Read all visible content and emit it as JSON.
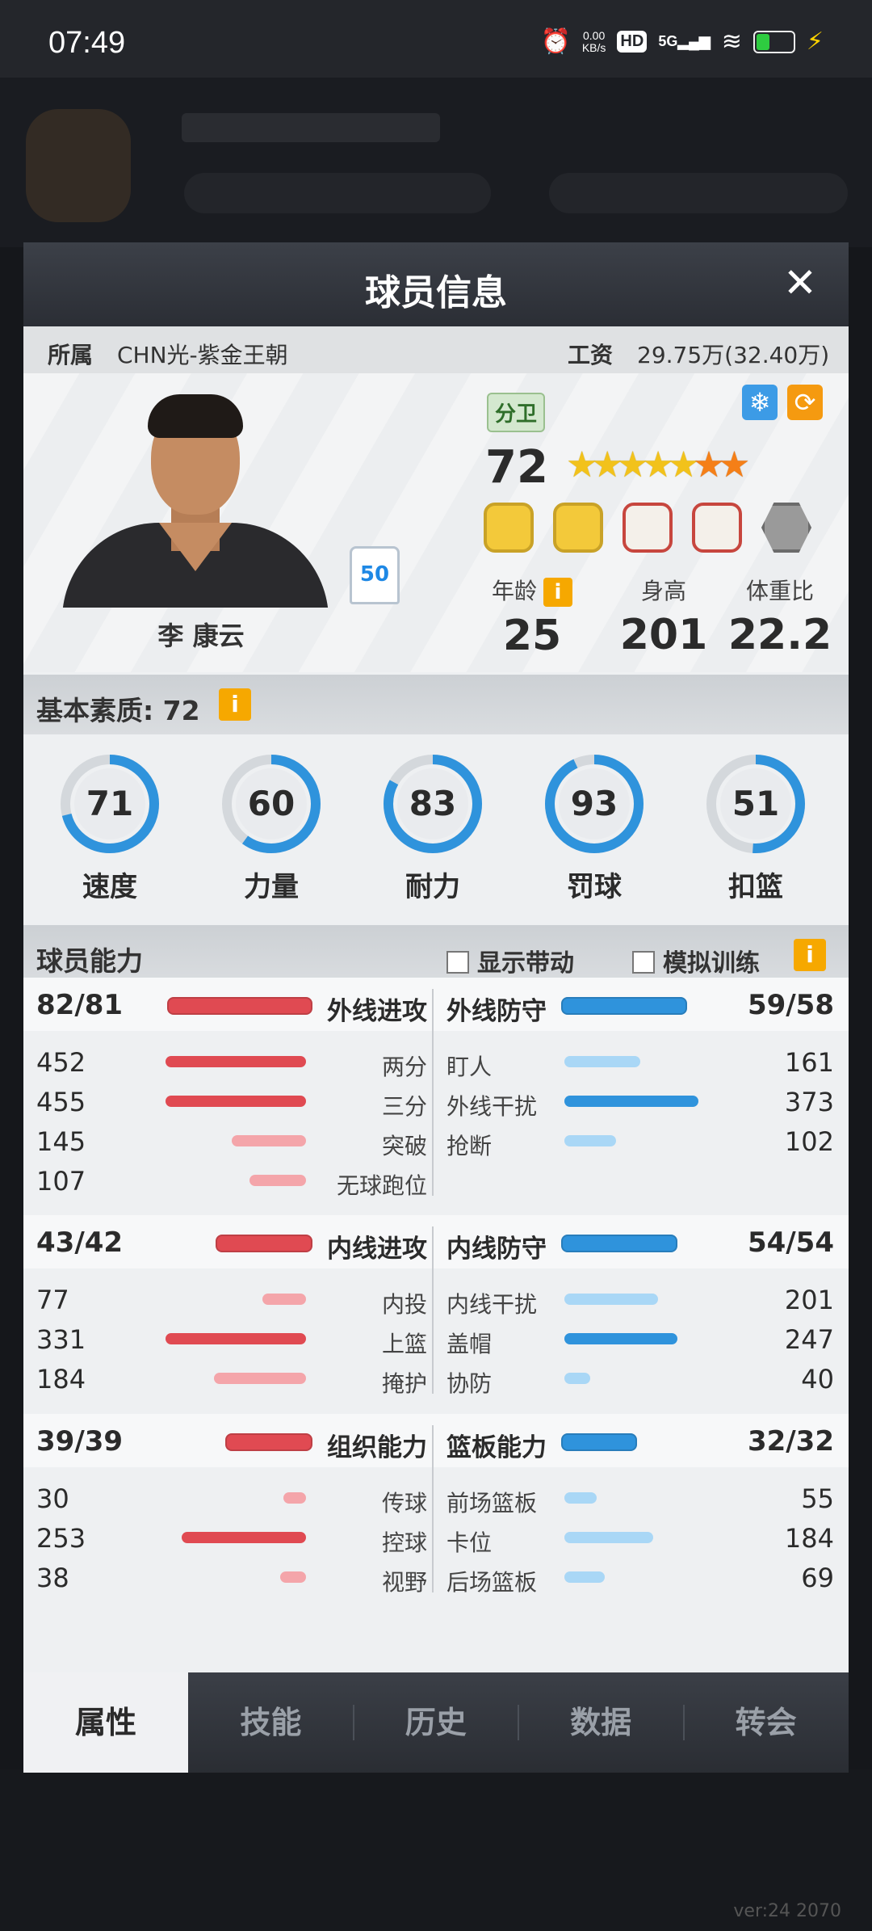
{
  "status_bar": {
    "time": "07:49",
    "net_speed": "0.00",
    "net_unit": "KB/s",
    "hd": "HD",
    "signal": "5G"
  },
  "background": {
    "version": "ver:24  2070"
  },
  "modal": {
    "title": "球员信息",
    "close": "✕"
  },
  "affiliation": {
    "team_label": "所属",
    "team": "CHN光-紫金王朝",
    "salary_label": "工资",
    "salary": "29.75万(32.40万)"
  },
  "player": {
    "name": "李 康云",
    "jersey_number": "50",
    "position": "分卫",
    "rating": "72",
    "stars_gold": 5,
    "stars_orange": 2,
    "age_label": "年龄",
    "age": "25",
    "height_label": "身高",
    "height": "201",
    "weight_ratio_label": "体重比",
    "weight_ratio": "22.2"
  },
  "basic": {
    "title": "基本素质: 72",
    "attrs": [
      {
        "label": "速度",
        "value": "71",
        "pct": 71
      },
      {
        "label": "力量",
        "value": "60",
        "pct": 60
      },
      {
        "label": "耐力",
        "value": "83",
        "pct": 83
      },
      {
        "label": "罚球",
        "value": "93",
        "pct": 93
      },
      {
        "label": "扣篮",
        "value": "51",
        "pct": 51
      }
    ]
  },
  "abilities": {
    "title": "球员能力",
    "show_drive": "显示带动",
    "sim_training": "模拟训练",
    "groups": [
      {
        "left": {
          "name": "外线进攻",
          "value": "82/81",
          "fill": 0.88
        },
        "right": {
          "name": "外线防守",
          "value": "59/58",
          "fill": 0.76
        },
        "rows": [
          {
            "l_label": "两分",
            "l_value": "452",
            "l_fill": 0.87,
            "r_label": "盯人",
            "r_value": "161",
            "r_fill": 0.47
          },
          {
            "l_label": "三分",
            "l_value": "455",
            "l_fill": 0.87,
            "r_label": "外线干扰",
            "r_value": "373",
            "r_fill": 0.83
          },
          {
            "l_label": "突破",
            "l_value": "145",
            "l_fill": 0.46,
            "r_label": "抢断",
            "r_value": "102",
            "r_fill": 0.32
          },
          {
            "l_label": "无球跑位",
            "l_value": "107",
            "l_fill": 0.35,
            "r_label": "",
            "r_value": "",
            "r_fill": 0
          }
        ]
      },
      {
        "left": {
          "name": "内线进攻",
          "value": "43/42",
          "fill": 0.58
        },
        "right": {
          "name": "内线防守",
          "value": "54/54",
          "fill": 0.7
        },
        "rows": [
          {
            "l_label": "内投",
            "l_value": "77",
            "l_fill": 0.27,
            "r_label": "内线干扰",
            "r_value": "201",
            "r_fill": 0.58
          },
          {
            "l_label": "上篮",
            "l_value": "331",
            "l_fill": 0.87,
            "r_label": "盖帽",
            "r_value": "247",
            "r_fill": 0.7
          },
          {
            "l_label": "掩护",
            "l_value": "184",
            "l_fill": 0.57,
            "r_label": "协防",
            "r_value": "40",
            "r_fill": 0.16
          }
        ]
      },
      {
        "left": {
          "name": "组织能力",
          "value": "39/39",
          "fill": 0.52
        },
        "right": {
          "name": "篮板能力",
          "value": "32/32",
          "fill": 0.45
        },
        "rows": [
          {
            "l_label": "传球",
            "l_value": "30",
            "l_fill": 0.14,
            "r_label": "前场篮板",
            "r_value": "55",
            "r_fill": 0.2
          },
          {
            "l_label": "控球",
            "l_value": "253",
            "l_fill": 0.77,
            "r_label": "卡位",
            "r_value": "184",
            "r_fill": 0.55
          },
          {
            "l_label": "视野",
            "l_value": "38",
            "l_fill": 0.16,
            "r_label": "后场篮板",
            "r_value": "69",
            "r_fill": 0.25
          }
        ]
      }
    ]
  },
  "tabs": [
    {
      "label": "属性",
      "active": true
    },
    {
      "label": "技能",
      "active": false
    },
    {
      "label": "历史",
      "active": false
    },
    {
      "label": "数据",
      "active": false
    },
    {
      "label": "转会",
      "active": false
    }
  ],
  "colors": {
    "bar_red": "#e04a52",
    "bar_red_light": "#f4a5aa",
    "bar_blue": "#2f93dc",
    "bar_blue_light": "#a9d7f6",
    "ring_blue": "#2f93dc",
    "ring_track": "#d4d8dc"
  }
}
